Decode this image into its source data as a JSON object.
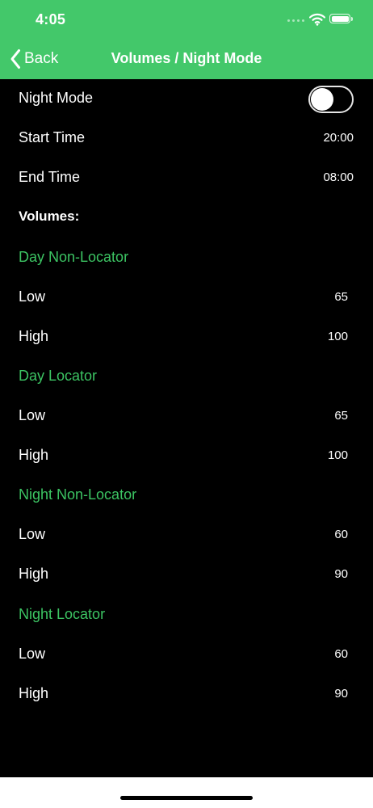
{
  "status_bar": {
    "time": "4:05",
    "icons": [
      "cellular-dots-icon",
      "wifi-icon",
      "battery-icon"
    ]
  },
  "nav": {
    "back_label": "Back",
    "title": "Volumes / Night Mode"
  },
  "settings": {
    "night_mode_label": "Night Mode",
    "night_mode_on": false,
    "start_time_label": "Start Time",
    "start_time_value": "20:00",
    "end_time_label": "End Time",
    "end_time_value": "08:00",
    "volumes_heading": "Volumes:"
  },
  "volume_sections": [
    {
      "title": "Day Non-Locator",
      "low_label": "Low",
      "low": "65",
      "high_label": "High",
      "high": "100"
    },
    {
      "title": "Day Locator",
      "low_label": "Low",
      "low": "65",
      "high_label": "High",
      "high": "100"
    },
    {
      "title": "Night Non-Locator",
      "low_label": "Low",
      "low": "60",
      "high_label": "High",
      "high": "90"
    },
    {
      "title": "Night Locator",
      "low_label": "Low",
      "low": "60",
      "high_label": "High",
      "high": "90"
    }
  ],
  "colors": {
    "header_background": "#43C86A",
    "section_title": "#3CC463",
    "content_background": "#000000",
    "text": "#FFFFFF"
  }
}
